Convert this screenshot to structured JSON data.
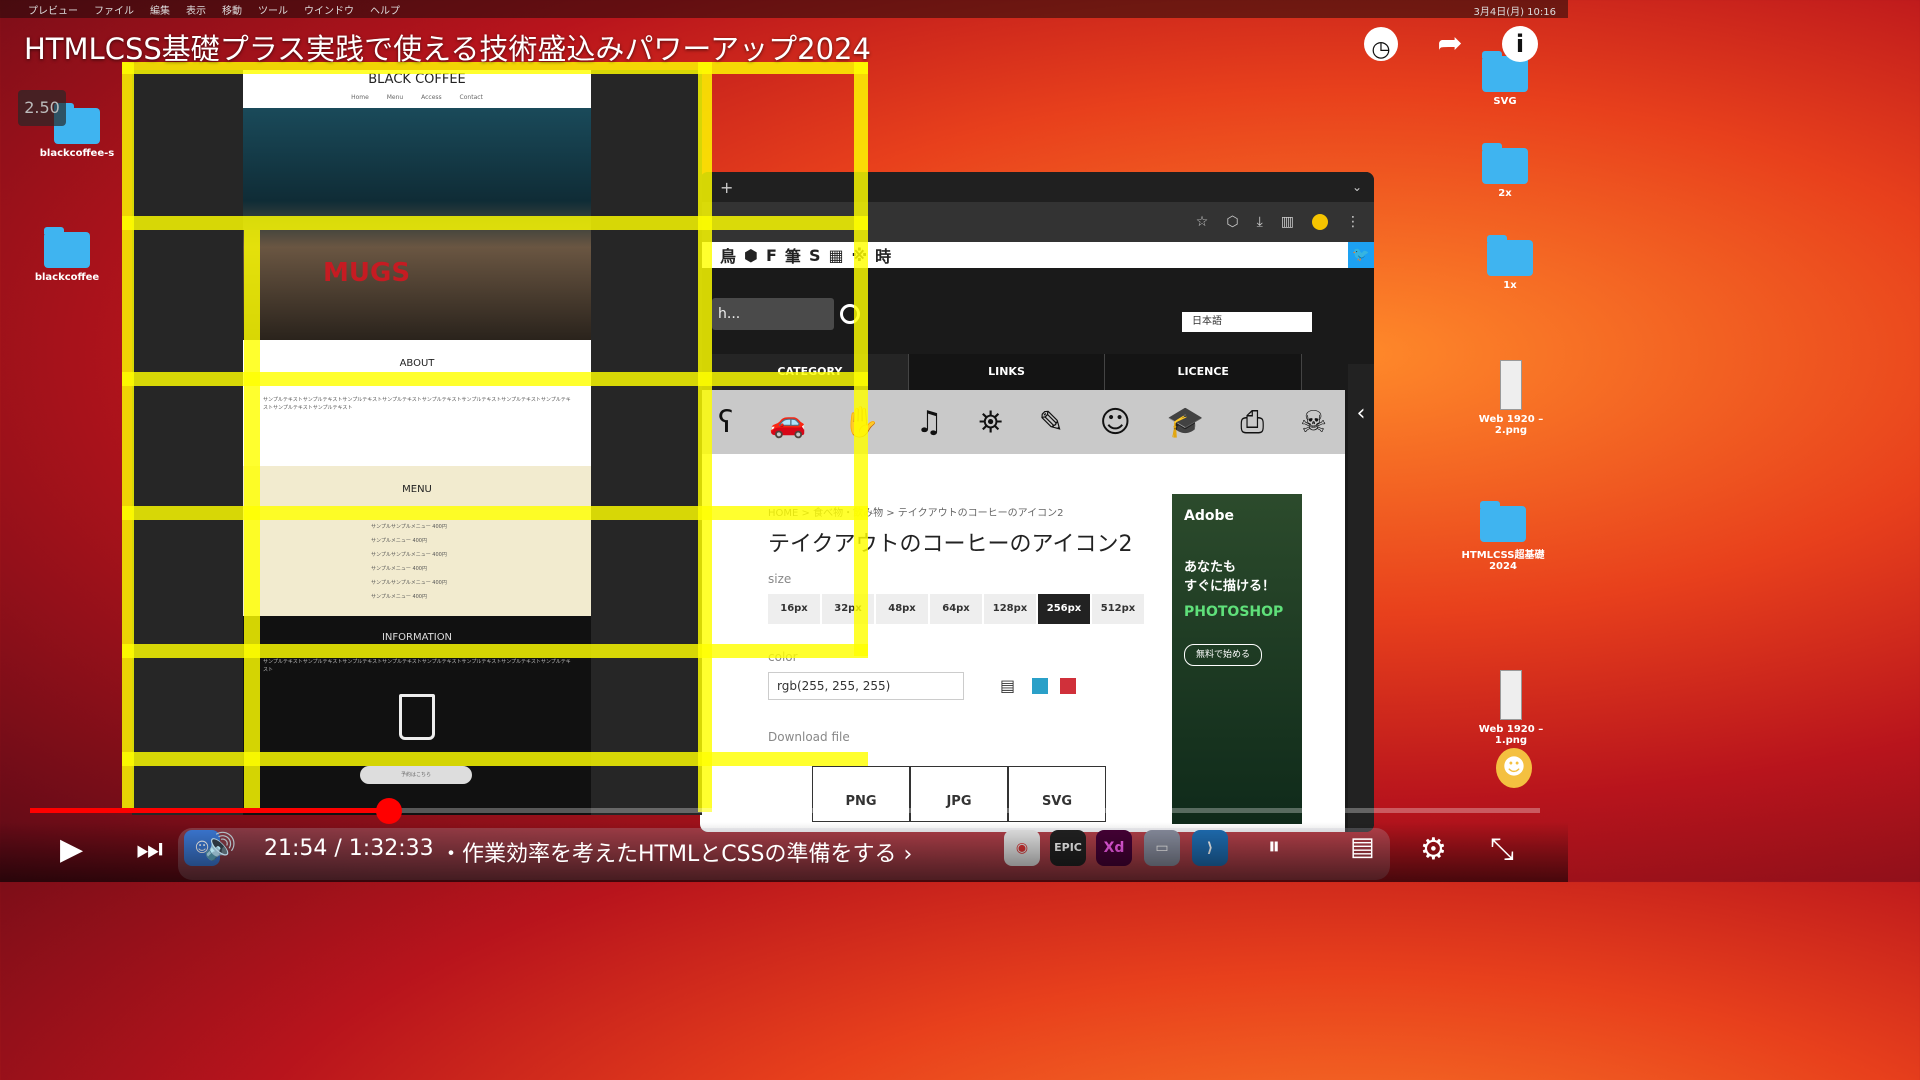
{
  "menubar": {
    "items": [
      "プレビュー",
      "ファイル",
      "編集",
      "表示",
      "移動",
      "ツール",
      "ウインドウ",
      "ヘルプ"
    ],
    "clock": "3月4日(月) 10:16"
  },
  "video": {
    "title": "HTMLCSS基礎プラス実践で使える技術盛込みパワーアップ2024",
    "speed": "2.50",
    "time": "21:54 / 1:32:33",
    "chapter": "・作業効率を考えたHTMLとCSSの準備をする",
    "progress_fraction": 0.238
  },
  "desktop": {
    "left": [
      {
        "label": "blackcoffee-s"
      },
      {
        "label": "blackcoffee"
      }
    ],
    "right": [
      {
        "label": "SVG"
      },
      {
        "label": "2x"
      },
      {
        "label": "1x"
      },
      {
        "label": "Web 1920 – 2.png"
      },
      {
        "label": "HTMLCSS超基礎 2024"
      },
      {
        "label": "Web 1920 – 1.png"
      }
    ]
  },
  "mock": {
    "site_title": "BLACK COFFEE",
    "nav": "Home Menu Access Contact",
    "mug_text": "MUGS",
    "about": "ABOUT",
    "about_text": "サンプルテキストサンプルテキストサンプルテキストサンプルテキストサンプルテキストサンプルテキストサンプルテキストサンプルテキストサンプルテキストサンプルテキスト",
    "menu": "MENU",
    "menu_items": [
      "サンプルサンプルメニュー 400円",
      "サンプルメニュー 400円",
      "サンプルサンプルメニュー 400円",
      "サンプルメニュー 400円",
      "サンプルサンプルメニュー 400円",
      "サンプルメニュー 400円"
    ],
    "info": "INFORMATION",
    "info_text": "サンプルテキストサンプルテキストサンプルテキストサンプルテキストサンプルテキストサンプルテキストサンプルテキストサンプルテキスト",
    "button": "予約はこちら"
  },
  "browser": {
    "tab_add": "+",
    "search_text": "h...",
    "language": "日本語",
    "nav": [
      "CATEGORY",
      "LINKS",
      "LICENCE"
    ],
    "icons": [
      "bear-icon",
      "car-icon",
      "hand-icon",
      "music-note-icon",
      "lighthouse-icon",
      "pencil-icon",
      "face-icon",
      "graduation-cap-icon",
      "printer-icon",
      "skull-icon"
    ],
    "breadcrumb": "HOME > 食べ物・飲み物 > テイクアウトのコーヒーのアイコン2",
    "page_title": "テイクアウトのコーヒーのアイコン2",
    "size_label": "size",
    "sizes": [
      "16px",
      "32px",
      "48px",
      "64px",
      "128px",
      "256px",
      "512px"
    ],
    "selected_size": "256px",
    "color_label": "color",
    "color_value": "rgb(255, 255, 255)",
    "download_label": "Download file",
    "formats": [
      "PNG",
      "JPG",
      "SVG"
    ],
    "ad": {
      "brand": "Adobe",
      "copy": "あなたも\nすぐに描ける！",
      "product": "PHOTOSHOP",
      "cta": "無料で始める"
    },
    "swatch_colors": [
      "#2aa0c8",
      "#d0303a"
    ]
  },
  "colors": {
    "progress": "#ff0000",
    "grid": "#ffff00"
  }
}
